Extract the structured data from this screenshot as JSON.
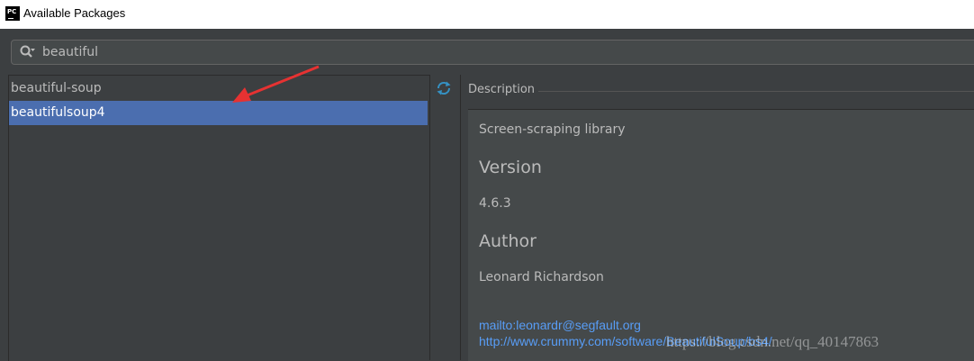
{
  "window": {
    "title": "Available Packages",
    "app_icon_text": "PC"
  },
  "search": {
    "query": "beautiful"
  },
  "packages": [
    {
      "name": "beautiful-soup"
    },
    {
      "name": "beautifulsoup4",
      "selected": true
    }
  ],
  "description": {
    "header": "Description",
    "summary": "Screen-scraping library",
    "version_heading": "Version",
    "version": "4.6.3",
    "author_heading": "Author",
    "author": "Leonard Richardson",
    "email_link": "mailto:leonardr@segfault.org",
    "homepage_link": "http://www.crummy.com/software/BeautifulSoup/bs4/"
  },
  "watermark": "https://blog.csdn.net/qq_40147863",
  "colors": {
    "selection": "#4b6eaf",
    "link": "#589df6",
    "refresh_icon": "#3592c4",
    "arrow": "#e63232"
  }
}
